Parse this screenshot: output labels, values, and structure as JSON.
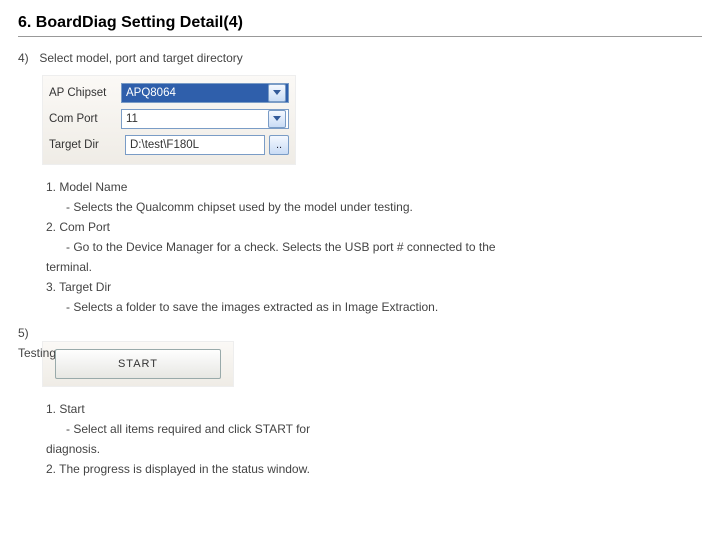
{
  "title": "6. BoardDiag Setting Detail(4)",
  "step4": {
    "num": "4)",
    "text": "Select model, port and target directory"
  },
  "form": {
    "chipset": {
      "label": "AP Chipset",
      "value": "APQ8064"
    },
    "comport": {
      "label": "Com Port",
      "value": "11"
    },
    "targetdir": {
      "label": "Target Dir",
      "value": "D:\\test\\F180L",
      "browse": ".."
    }
  },
  "desc1": {
    "l1": "1.   Model Name",
    "l1d": "- Selects the Qualcomm chipset used by the model under testing.",
    "l2": "2. Com Port",
    "l2d": "- Go to the Device Manager for a check. Selects the USB port # connected to the",
    "l2d2": "terminal.",
    "l3": "3. Target Dir",
    "l3d": "- Selects a folder to save the images extracted as in Image Extraction."
  },
  "step5": {
    "num": "5)",
    "text": "Testing"
  },
  "start_label": "START",
  "desc2": {
    "l1": "1.   Start",
    "l1d": "- Select all items required and click START for",
    "l1d2": "diagnosis.",
    "l2": "2.  The progress is displayed in the status window."
  }
}
